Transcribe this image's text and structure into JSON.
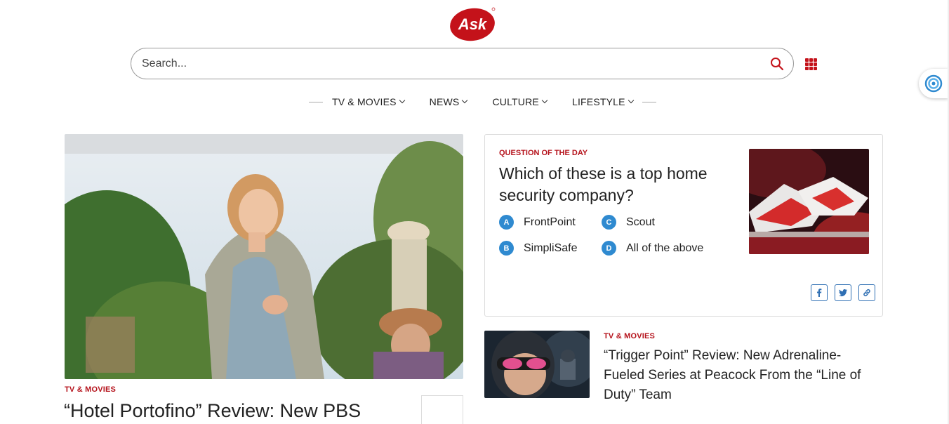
{
  "header": {
    "logo_text": "Ask",
    "brand_color": "#c4121a"
  },
  "search": {
    "placeholder": "Search...",
    "value": ""
  },
  "nav": {
    "items": [
      {
        "label": "TV & MOVIES"
      },
      {
        "label": "NEWS"
      },
      {
        "label": "CULTURE"
      },
      {
        "label": "LIFESTYLE"
      }
    ]
  },
  "hero": {
    "category": "TV & MOVIES",
    "title": "“Hotel Portofino” Review: New PBS"
  },
  "qotd": {
    "label": "QUESTION OF THE DAY",
    "question": "Which of these is a top home security company?",
    "answers": [
      {
        "letter": "A",
        "text": "FrontPoint"
      },
      {
        "letter": "B",
        "text": "SimpliSafe"
      },
      {
        "letter": "C",
        "text": "Scout"
      },
      {
        "letter": "D",
        "text": "All of the above"
      }
    ],
    "badge_color": "#2f8ad0"
  },
  "story2": {
    "category": "TV & MOVIES",
    "title": "“Trigger Point” Review: New Adrenaline-Fueled Series at Peacock From the “Line of Duty” Team"
  },
  "colors": {
    "accent": "#b5121b",
    "share_border": "#2f6fb3"
  }
}
